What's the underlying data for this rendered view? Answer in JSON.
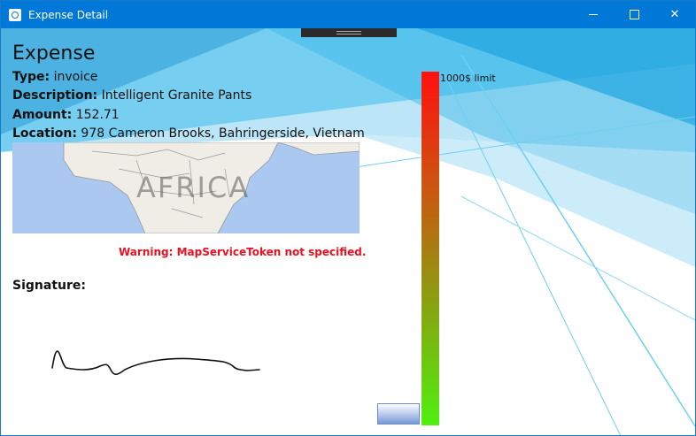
{
  "window": {
    "title": "Expense Detail"
  },
  "expense": {
    "heading": "Expense",
    "type_label": "Type:",
    "type_value": "invoice",
    "description_label": "Description:",
    "description_value": "Intelligent Granite Pants",
    "amount_label": "Amount:",
    "amount_value": "152.71",
    "location_label": "Location:",
    "location_value": "978 Cameron Brooks, Bahringerside, Vietnam"
  },
  "map": {
    "region_label": "AFRICA"
  },
  "warning": "Warning: MapServiceToken not specified.",
  "signature": {
    "label": "Signature:"
  },
  "limit": {
    "label": "1000$ limit",
    "max": 1000,
    "amount": 152.71
  },
  "colors": {
    "titlebar": "#0078d7",
    "warning": "#e81123",
    "limit_top": "#ff1010",
    "limit_bottom": "#50f010"
  }
}
